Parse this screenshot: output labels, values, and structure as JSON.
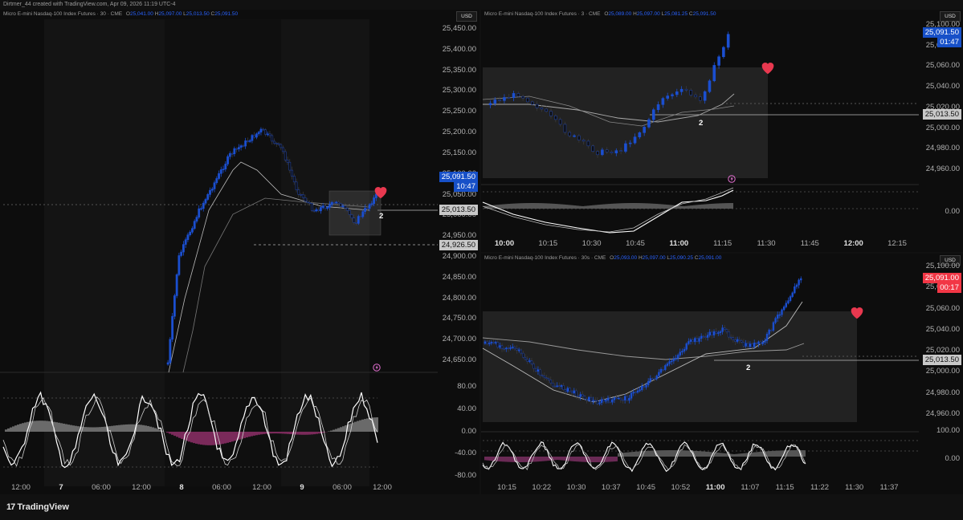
{
  "attribution": "Dirtmer_44 created with TradingView.com, Apr 09, 2026 11:19 UTC-4",
  "brand": "TradingView",
  "colors": {
    "up": "#1b4fd0",
    "accent_blue": "#1750c8",
    "red": "#f23645",
    "heart": "#e8384f",
    "pink": "#e26fd0"
  },
  "panels": {
    "left": {
      "symbol": "Micro E-mini Nasdaq-100 Index Futures · 30 · CME",
      "o": "25,041.00",
      "h": "25,097.00",
      "l": "25,013.50",
      "c": "25,091.50",
      "currency": "USD",
      "price_axis": [
        "25,450.00",
        "25,400.00",
        "25,350.00",
        "25,300.00",
        "25,250.00",
        "25,200.00",
        "25,150.00",
        "25,100.00",
        "25,050.00",
        "25,000.00",
        "24,950.00",
        "24,900.00",
        "24,850.00",
        "24,800.00",
        "24,750.00",
        "24,700.00",
        "24,650.00"
      ],
      "osc_axis": [
        "80.00",
        "40.00",
        "0.00",
        "-40.00",
        "-80.00"
      ],
      "time_axis": [
        {
          "t": "12:00",
          "bold": false
        },
        {
          "t": "7",
          "bold": true
        },
        {
          "t": "06:00",
          "bold": false
        },
        {
          "t": "12:00",
          "bold": false
        },
        {
          "t": "8",
          "bold": true
        },
        {
          "t": "06:00",
          "bold": false
        },
        {
          "t": "12:00",
          "bold": false
        },
        {
          "t": "9",
          "bold": true
        },
        {
          "t": "06:00",
          "bold": false
        },
        {
          "t": "12:00",
          "bold": false
        }
      ],
      "last_price": "25,091.50",
      "countdown": "10:47",
      "level_1": "25,013.50",
      "level_2": "24,926.50",
      "count_label": "2"
    },
    "top_right": {
      "symbol": "Micro E-mini Nasdaq-100 Index Futures · 3 · CME",
      "o": "25,089.00",
      "h": "25,097.00",
      "l": "25,081.25",
      "c": "25,091.50",
      "currency": "USD",
      "price_axis": [
        "25,100.00",
        "25,080.00",
        "25,060.00",
        "25,040.00",
        "25,020.00",
        "25,000.00",
        "24,980.00",
        "24,960.00"
      ],
      "osc_axis": [
        "0.00"
      ],
      "time_axis": [
        {
          "t": "10:00",
          "bold": true
        },
        {
          "t": "10:15",
          "bold": false
        },
        {
          "t": "10:30",
          "bold": false
        },
        {
          "t": "10:45",
          "bold": false
        },
        {
          "t": "11:00",
          "bold": true
        },
        {
          "t": "11:15",
          "bold": false
        },
        {
          "t": "11:30",
          "bold": false
        },
        {
          "t": "11:45",
          "bold": false
        },
        {
          "t": "12:00",
          "bold": true
        },
        {
          "t": "12:15",
          "bold": false
        }
      ],
      "last_price": "25,091.50",
      "countdown": "01:47",
      "level_1": "25,013.50",
      "count_label": "2"
    },
    "bottom_right": {
      "symbol": "Micro E-mini Nasdaq-100 Index Futures · 30s · CME",
      "o": "25,093.00",
      "h": "25,097.00",
      "l": "25,090.25",
      "c": "25,091.00",
      "currency": "USD",
      "price_axis": [
        "25,100.00",
        "25,080.00",
        "25,060.00",
        "25,040.00",
        "25,020.00",
        "25,000.00",
        "24,980.00",
        "24,960.00"
      ],
      "osc_axis": [
        "100.00",
        "0.00"
      ],
      "time_axis": [
        {
          "t": "10:15",
          "bold": false
        },
        {
          "t": "10:22",
          "bold": false
        },
        {
          "t": "10:30",
          "bold": false
        },
        {
          "t": "10:37",
          "bold": false
        },
        {
          "t": "10:45",
          "bold": false
        },
        {
          "t": "10:52",
          "bold": false
        },
        {
          "t": "11:00",
          "bold": true
        },
        {
          "t": "11:07",
          "bold": false
        },
        {
          "t": "11:15",
          "bold": false
        },
        {
          "t": "11:22",
          "bold": false
        },
        {
          "t": "11:30",
          "bold": false
        },
        {
          "t": "11:37",
          "bold": false
        }
      ],
      "last_price": "25,091.00",
      "countdown": "00:17",
      "level_1": "25,013.50",
      "count_label": "2"
    }
  }
}
